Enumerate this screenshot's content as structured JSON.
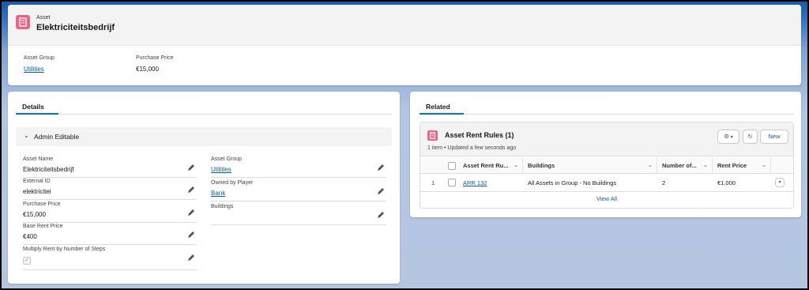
{
  "header": {
    "record_type": "Asset",
    "record_name": "Elektriciteitsbedrijf",
    "highlights": [
      {
        "label": "Asset Group",
        "value": "Utilities"
      },
      {
        "label": "Purchase Price",
        "value": "€15,000"
      }
    ]
  },
  "details": {
    "tab_label": "Details",
    "section_title": "Admin Editable",
    "left_fields": [
      {
        "label": "Asset Name",
        "value": "Elektriciteitsbedrijf"
      },
      {
        "label": "External ID",
        "value": "elektricitei"
      },
      {
        "label": "Purchase Price",
        "value": "€15,000"
      },
      {
        "label": "Base Rent Price",
        "value": "€400"
      },
      {
        "label": "Multiply Rent by Number of Steps",
        "value": "✓"
      }
    ],
    "right_fields": [
      {
        "label": "Asset Group",
        "value": "Utilities"
      },
      {
        "label": "Owned by Player",
        "value": "Bank"
      },
      {
        "label": "Buildings",
        "value": ""
      }
    ]
  },
  "related": {
    "tab_label": "Related",
    "list_title": "Asset Rent Rules (1)",
    "list_subtitle": "1 item • Updated a few seconds ago",
    "new_button": "New",
    "columns": [
      "Asset Rent Ru...",
      "Buildings",
      "Number of...",
      "Rent Price"
    ],
    "rows": [
      {
        "num": "1",
        "name": "ARR 132",
        "buildings": "All Assets in Group - No Buildings",
        "number": "2",
        "rent": "€1,000"
      }
    ],
    "view_all": "View All"
  },
  "icons": {
    "record": "building-icon",
    "edit": "pencil-icon",
    "settings": "gear-icon",
    "refresh": "refresh-icon",
    "sort": "chevron-down-icon"
  },
  "colors": {
    "brand_blue": "#0176d3",
    "link": "#0b5cab",
    "asset_icon": "#e3678b"
  }
}
